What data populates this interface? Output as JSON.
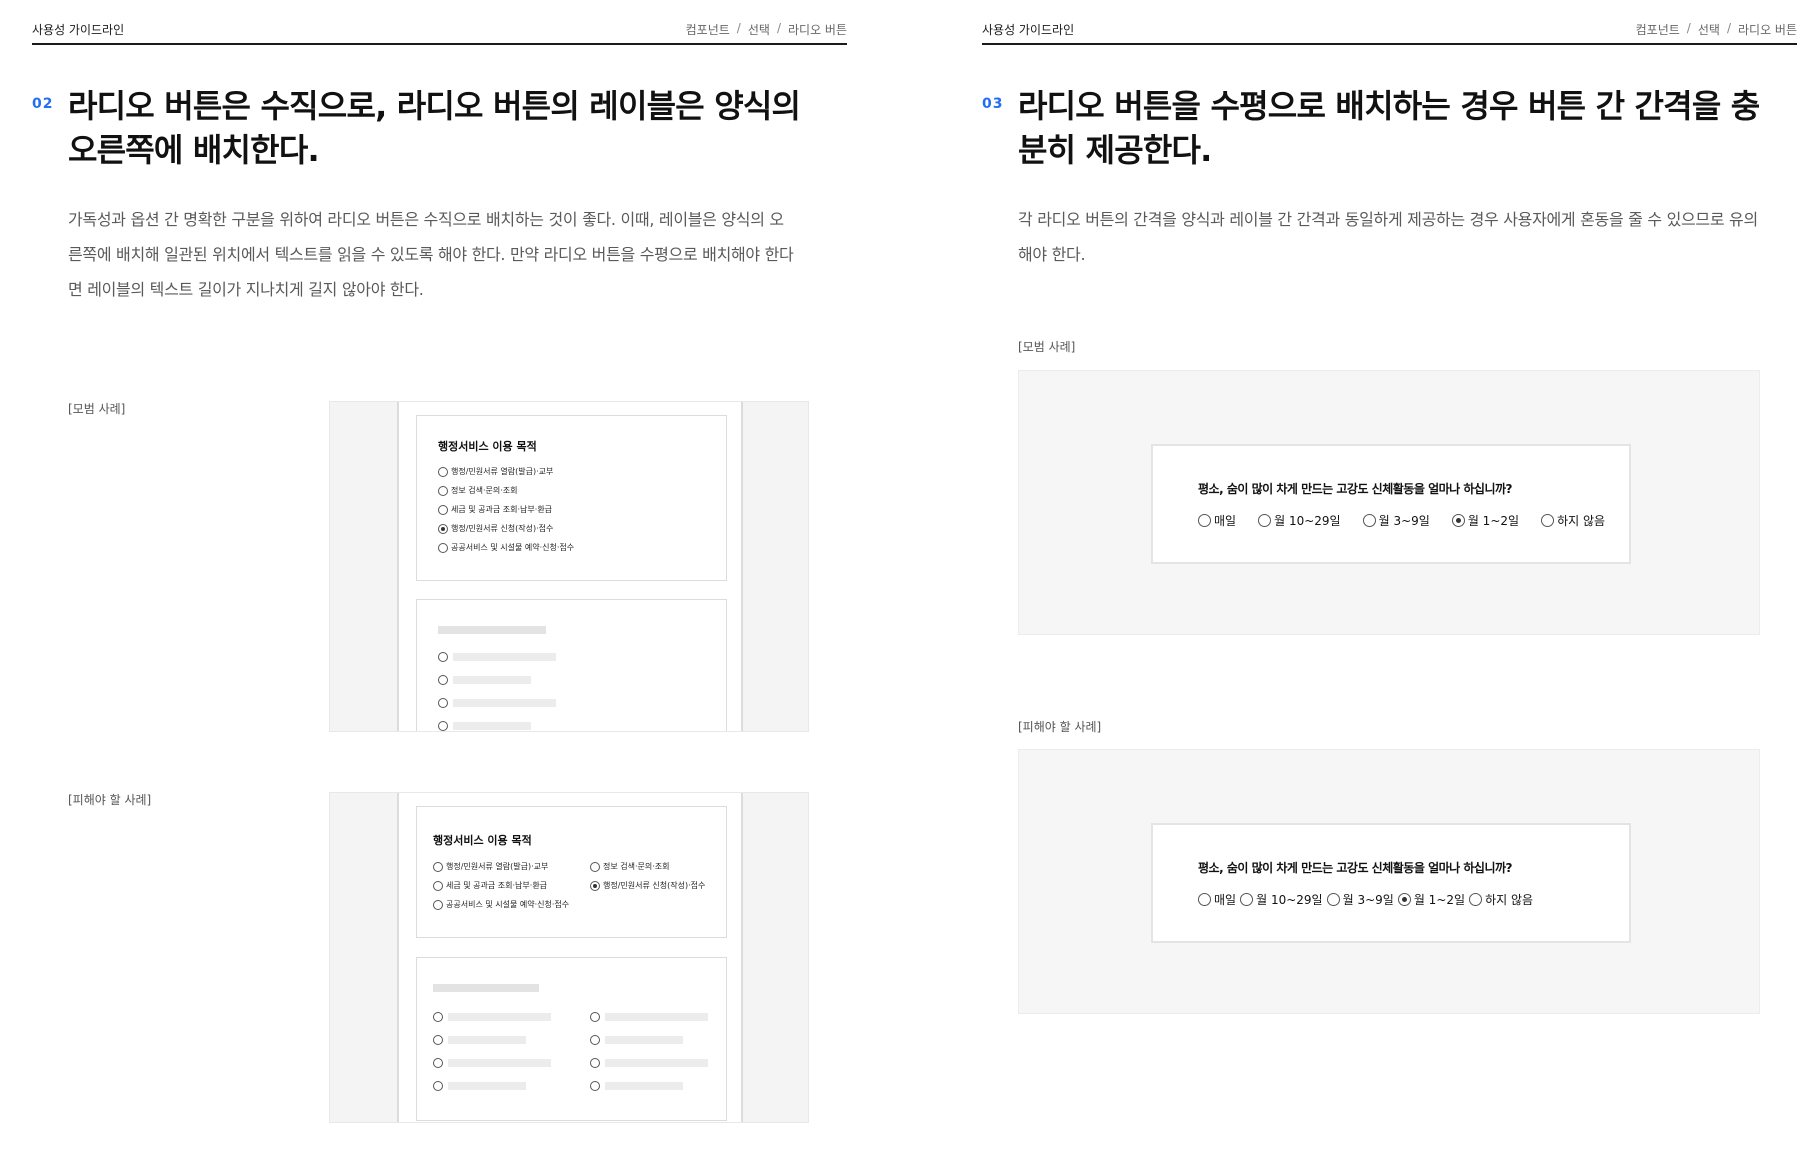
{
  "left_page": {
    "header": {
      "brand": "사용성 가이드라인",
      "crumbs": [
        "컴포넌트",
        "선택",
        "라디오 버튼"
      ],
      "separator": "/"
    },
    "number": "02",
    "title": "라디오 버튼은 수직으로, 라디오 버튼의 레이블은 양식의 오른쪽에 배치한다.",
    "description": "가독성과 옵션 간 명확한 구분을 위하여 라디오 버튼은 수직으로 배치하는 것이 좋다. 이때, 레이블은 양식의 오른쪽에 배치해 일관된 위치에서 텍스트를 읽을 수 있도록 해야 한다. 만약 라디오 버튼을 수평으로 배치해야 한다면 레이블의 텍스트 길이가 지나치게 길지 않아야 한다.",
    "good_label": "[모범 사례]",
    "bad_label": "[피해야 할 사례]",
    "good_example": {
      "title": "행정서비스 이용 목적",
      "options": [
        {
          "label": "행정/민원서류 열람(발급)·교부",
          "selected": false
        },
        {
          "label": "정보 검색·문의·조회",
          "selected": false
        },
        {
          "label": "세금 및 공과금 조회·납부·환급",
          "selected": false
        },
        {
          "label": "행정/민원서류 신청(작성)·접수",
          "selected": true
        },
        {
          "label": "공공서비스 및 시설물 예약·신청·접수",
          "selected": false
        }
      ]
    },
    "bad_example": {
      "title": "행정서비스 이용 목적",
      "options": [
        {
          "label": "행정/민원서류 열람(발급)·교부",
          "selected": false
        },
        {
          "label": "정보 검색·문의·조회",
          "selected": false
        },
        {
          "label": "세금 및 공과금 조회·납부·환급",
          "selected": false
        },
        {
          "label": "행정/민원서류 신청(작성)·접수",
          "selected": true
        },
        {
          "label": "공공서비스 및 시설물 예약·신청·접수",
          "selected": false
        }
      ]
    }
  },
  "right_page": {
    "header": {
      "brand": "사용성 가이드라인",
      "crumbs": [
        "컴포넌트",
        "선택",
        "라디오 버튼"
      ],
      "separator": "/"
    },
    "number": "03",
    "title": "라디오 버튼을 수평으로 배치하는 경우 버튼 간 간격을 충분히 제공한다.",
    "description": "각 라디오 버튼의 간격을 양식과 레이블 간 간격과 동일하게 제공하는 경우 사용자에게 혼동을 줄 수 있으므로 유의해야 한다.",
    "good_label": "[모범 사례]",
    "bad_label": "[피해야 할 사례]",
    "good_example": {
      "question": "평소, 숨이 많이 차게 만드는 고강도 신체활동을 얼마나 하십니까?",
      "options": [
        {
          "label": "매일",
          "selected": false
        },
        {
          "label": "월 10~29일",
          "selected": false
        },
        {
          "label": "월 3~9일",
          "selected": false
        },
        {
          "label": "월 1~2일",
          "selected": true
        },
        {
          "label": "하지 않음",
          "selected": false
        }
      ]
    },
    "bad_example": {
      "question": "평소, 숨이 많이 차게 만드는 고강도 신체활동을 얼마나 하십니까?",
      "options": [
        {
          "label": "매일",
          "selected": false
        },
        {
          "label": "월 10~29일",
          "selected": false
        },
        {
          "label": "월 3~9일",
          "selected": false
        },
        {
          "label": "월 1~2일",
          "selected": true
        },
        {
          "label": "하지 않음",
          "selected": false
        }
      ]
    }
  },
  "colors": {
    "accent": "#256ef4",
    "text": "#1b1b1b",
    "muted": "#5a5a5a",
    "pane_bg": "#f6f6f6"
  }
}
